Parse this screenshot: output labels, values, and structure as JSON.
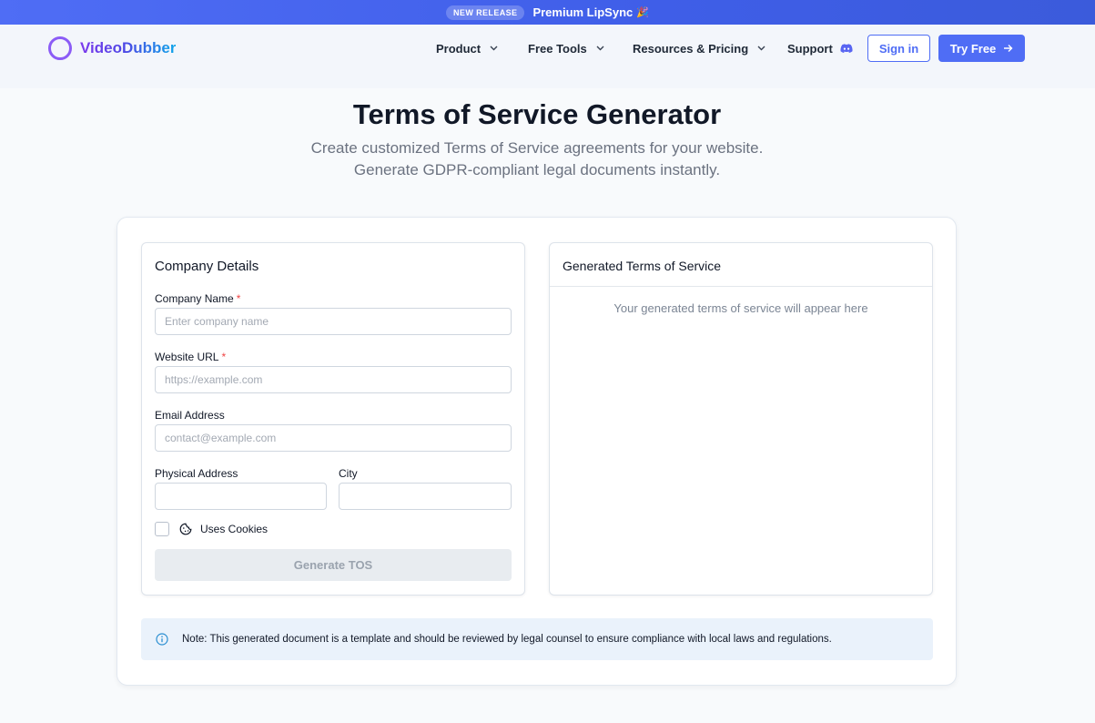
{
  "banner": {
    "badge": "NEW RELEASE",
    "text": "Premium LipSync",
    "emoji": "🎉"
  },
  "header": {
    "logo": "VideoDubber",
    "nav": [
      {
        "label": "Product",
        "has_dropdown": true
      },
      {
        "label": "Free Tools",
        "has_dropdown": true
      },
      {
        "label": "Resources & Pricing",
        "has_dropdown": true
      },
      {
        "label": "Support",
        "icon": "discord-icon"
      }
    ],
    "signin_label": "Sign in",
    "try_label": "Try Free",
    "chevron": "⌄",
    "arrow": "→"
  },
  "hero": {
    "title": "Terms of Service Generator",
    "subtitle_line1": "Create customized Terms of Service agreements for your website.",
    "subtitle_line2": "Generate GDPR-compliant legal documents instantly."
  },
  "form": {
    "title": "Company Details",
    "fields": {
      "company_name": {
        "label": "Company Name",
        "required_mark": "*",
        "placeholder": "Enter company name",
        "value": ""
      },
      "website_url": {
        "label": "Website URL",
        "required_mark": "*",
        "placeholder": "https://example.com",
        "value": ""
      },
      "email": {
        "label": "Email Address",
        "placeholder": "contact@example.com",
        "value": ""
      },
      "physical_address": {
        "label": "Physical Address",
        "placeholder": "",
        "value": ""
      },
      "city": {
        "label": "City",
        "placeholder": "",
        "value": ""
      }
    },
    "cookies_label": "Uses Cookies",
    "cookies_checked": false,
    "generate_label": "Generate TOS"
  },
  "output": {
    "title": "Generated Terms of Service",
    "placeholder": "Your generated terms of service will appear here"
  },
  "note": {
    "text": "Note: This generated document is a template and should be reviewed by legal counsel to ensure compliance with local laws and regulations."
  },
  "colors": {
    "brand": "#4f6df5",
    "logo_ring": "#8b5cf6",
    "required": "#ef4444",
    "note_bg": "#eaf2fb",
    "info_icon": "#2b8fd1"
  }
}
